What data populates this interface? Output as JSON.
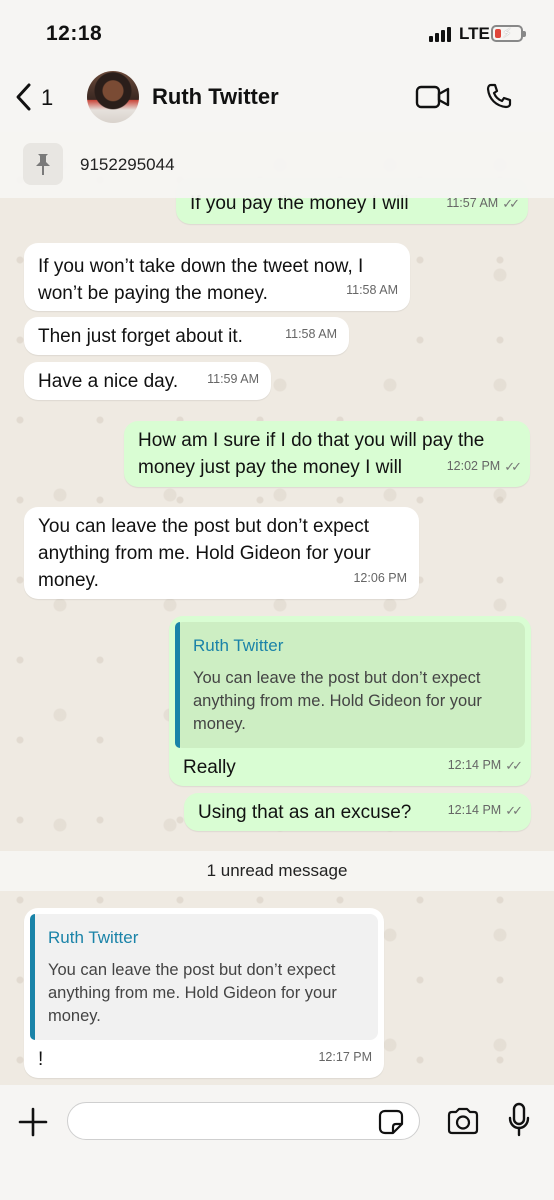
{
  "status_bar": {
    "time": "12:18",
    "network": "LTE"
  },
  "header": {
    "back_count": "1",
    "contact_name": "Ruth Twitter"
  },
  "pinned": {
    "text": "9152295044"
  },
  "messages": [
    {
      "dir": "out",
      "text": "If you pay the money I will",
      "time": "11:57 AM",
      "read": true
    },
    {
      "dir": "in",
      "text": "If you won’t take down the tweet now, I won’t be paying the money.",
      "time": "11:58 AM"
    },
    {
      "dir": "in",
      "text": "Then just forget about it.",
      "time": "11:58 AM"
    },
    {
      "dir": "in",
      "text": "Have a nice day.",
      "time": "11:59 AM"
    },
    {
      "dir": "out",
      "text": "How am I sure if I do that you will pay the money just pay the money I will",
      "time": "12:02 PM",
      "read": true
    },
    {
      "dir": "in",
      "text": "You can leave the post but don’t expect anything from me. Hold Gideon for your money.",
      "time": "12:06 PM"
    },
    {
      "dir": "out",
      "quote_author": "Ruth Twitter",
      "quote_text": "You can leave the post but don’t expect anything from me. Hold Gideon for your money.",
      "text": "Really",
      "time": "12:14 PM",
      "read": true
    },
    {
      "dir": "out",
      "text": "Using that as an excuse?",
      "time": "12:14 PM",
      "read": true
    },
    {
      "dir": "in",
      "quote_author": "Ruth Twitter",
      "quote_text": "You can leave the post but don’t expect anything from me. Hold Gideon for your money.",
      "text": "!",
      "time": "12:17 PM"
    }
  ],
  "unread_banner": "1 unread message",
  "input": {
    "placeholder": ""
  },
  "icons": [
    "back-chevron-icon",
    "video-call-icon",
    "phone-icon",
    "pin-icon",
    "read-ticks-icon",
    "plus-icon",
    "sticker-icon",
    "camera-icon",
    "mic-icon"
  ],
  "colors": {
    "outgoing_bubble": "#d9fdd3",
    "incoming_bubble": "#ffffff",
    "quote_accent": "#1a83a8",
    "chat_bg": "#efeae2"
  }
}
